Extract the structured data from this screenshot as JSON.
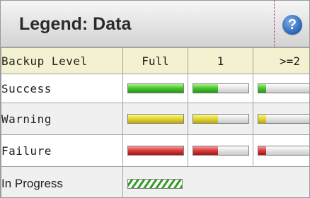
{
  "legend": {
    "title": "Legend: Data",
    "help_glyph": "?",
    "columns": [
      "Backup Level",
      "Full",
      "1",
      ">=2"
    ],
    "rows": [
      {
        "label": "Success",
        "color": "#3fbf2a",
        "levels": [
          1.0,
          0.45,
          0.14
        ]
      },
      {
        "label": "Warning",
        "color": "#e0d42a",
        "levels": [
          1.0,
          0.45,
          0.14
        ]
      },
      {
        "label": "Failure",
        "color": "#d83434",
        "levels": [
          1.0,
          0.45,
          0.14
        ]
      },
      {
        "label": "In Progress",
        "indicator": "striped-progress-bar"
      }
    ]
  }
}
